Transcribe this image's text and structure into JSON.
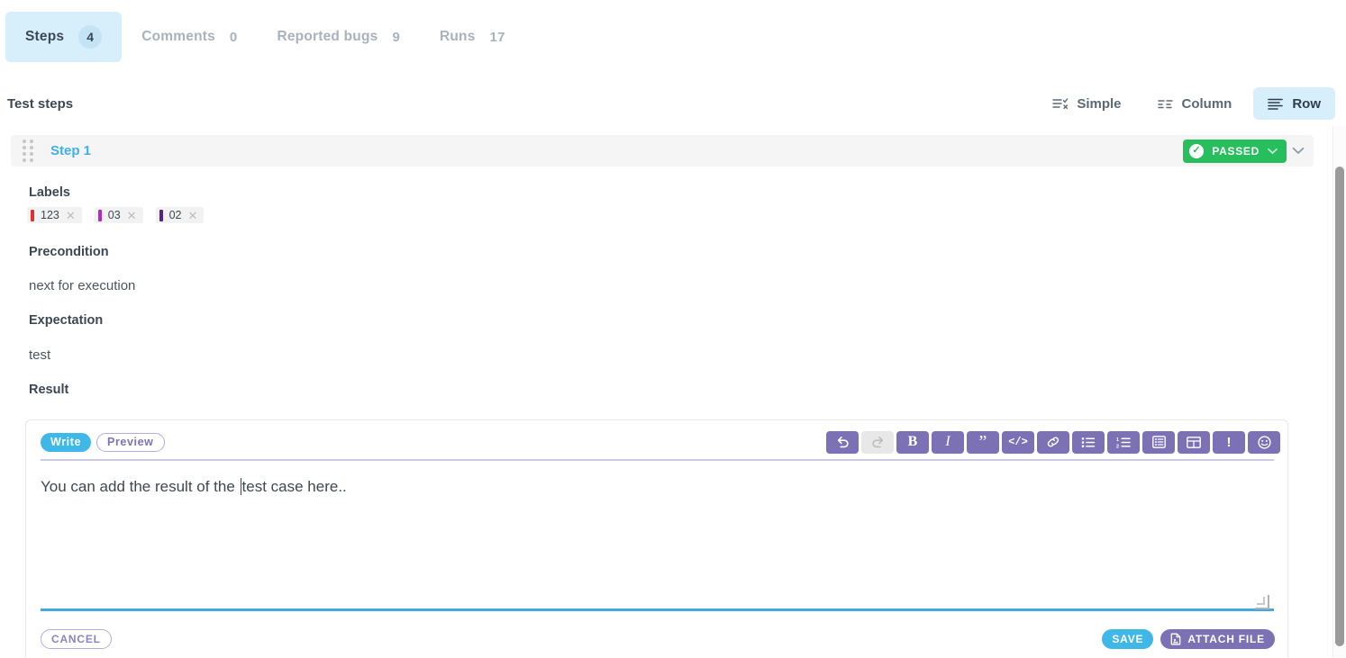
{
  "tabs": [
    {
      "label": "Steps",
      "count": "4",
      "active": true
    },
    {
      "label": "Comments",
      "count": "0",
      "active": false
    },
    {
      "label": "Reported bugs",
      "count": "9",
      "active": false
    },
    {
      "label": "Runs",
      "count": "17",
      "active": false
    }
  ],
  "section": {
    "title": "Test steps",
    "view_modes": [
      {
        "label": "Simple",
        "icon": "simple-view-icon",
        "active": false
      },
      {
        "label": "Column",
        "icon": "column-view-icon",
        "active": false
      },
      {
        "label": "Row",
        "icon": "row-view-icon",
        "active": true
      }
    ]
  },
  "step": {
    "title": "Step 1",
    "status": "PASSED",
    "status_color": "#27bf5d",
    "labels_heading": "Labels",
    "labels": [
      {
        "text": "123",
        "color": "#e03131"
      },
      {
        "text": "03",
        "color": "#b32bc4"
      },
      {
        "text": "02",
        "color": "#5b1e8c"
      }
    ],
    "fields": [
      {
        "heading": "Precondition",
        "value": "next for execution"
      },
      {
        "heading": "Expectation",
        "value": "test"
      }
    ],
    "result_heading": "Result"
  },
  "editor": {
    "tabs": [
      {
        "label": "Write",
        "active": true
      },
      {
        "label": "Preview",
        "active": false
      }
    ],
    "text_before_caret": "You can add the result of the ",
    "text_after_caret": "test case here..",
    "toolbar": [
      {
        "name": "undo-icon",
        "title": "Undo",
        "disabled": false
      },
      {
        "name": "redo-icon",
        "title": "Redo",
        "disabled": true
      },
      {
        "name": "bold-icon",
        "title": "Bold",
        "disabled": false
      },
      {
        "name": "italic-icon",
        "title": "Italic",
        "disabled": false
      },
      {
        "name": "quote-icon",
        "title": "Quote",
        "disabled": false
      },
      {
        "name": "code-icon",
        "title": "Code",
        "disabled": false
      },
      {
        "name": "link-icon",
        "title": "Link",
        "disabled": false
      },
      {
        "name": "bullet-list-icon",
        "title": "Bulleted list",
        "disabled": false
      },
      {
        "name": "numbered-list-icon",
        "title": "Numbered list",
        "disabled": false
      },
      {
        "name": "task-list-icon",
        "title": "Task list",
        "disabled": false
      },
      {
        "name": "table-icon",
        "title": "Table",
        "disabled": false
      },
      {
        "name": "alert-icon",
        "title": "Alert",
        "disabled": false
      },
      {
        "name": "emoji-icon",
        "title": "Emoji",
        "disabled": false
      }
    ],
    "cancel_label": "CANCEL",
    "save_label": "SAVE",
    "attach_label": "ATTACH FILE"
  },
  "colors": {
    "accent_blue": "#3fb8e8",
    "accent_purple": "#7d71b5",
    "tab_active_bg": "#d7eefb",
    "passed_green": "#27bf5d"
  }
}
